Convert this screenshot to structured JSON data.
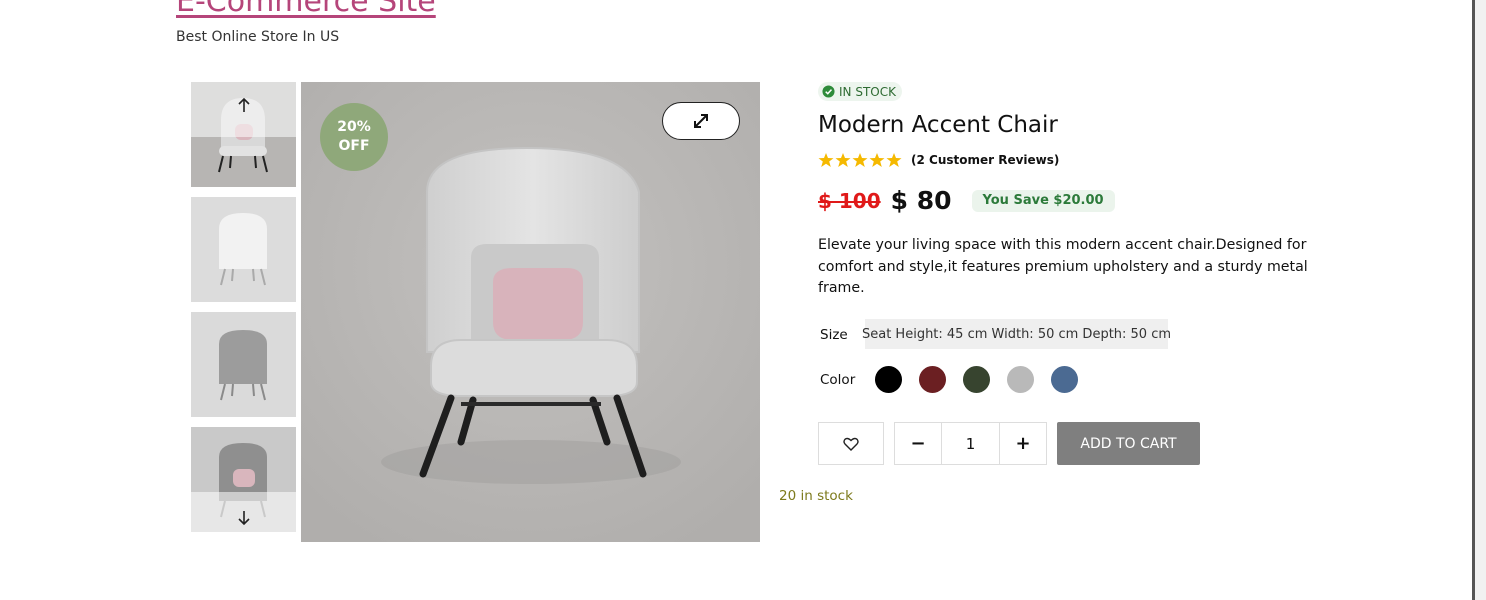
{
  "site": {
    "title": "E-Commerce Site",
    "tagline": "Best Online Store In US"
  },
  "gallery": {
    "discount_badge": {
      "line1": "20%",
      "line2": "OFF",
      "color": "#8fa87a"
    },
    "thumbnails": [
      {
        "label": "chair-front",
        "arrow": "arrow-up-icon"
      },
      {
        "label": "chair-back-white"
      },
      {
        "label": "chair-back-grey"
      },
      {
        "label": "chair-back-grey-cushion",
        "arrow": "arrow-down-icon"
      }
    ],
    "expand_icon": "expand-icon"
  },
  "product": {
    "stock_badge": "IN STOCK",
    "title": "Modern Accent Chair",
    "rating": 5,
    "reviews_text": "(2 Customer Reviews)",
    "old_price": "$ 100",
    "new_price": "$ 80",
    "save_text": "You Save $20.00",
    "description": "Elevate your living space with this modern accent chair.Designed for comfort and style,it features premium upholstery and a sturdy metal frame.",
    "size_label": "Size",
    "size_value": "Seat Height: 45 cm Width: 50 cm Depth: 50 cm",
    "color_label": "Color",
    "colors": [
      "#000000",
      "#6b1f22",
      "#37442f",
      "#b9b9b9",
      "#4b6a92"
    ],
    "quantity": "1",
    "minus_label": "−",
    "plus_label": "+",
    "add_to_cart_label": "ADD TO CART",
    "stock_count": "20 in stock"
  },
  "colors": {
    "title_link": "#b5457a",
    "old_price": "#e01919",
    "save_text": "#2c7a3a",
    "in_stock": "#2e6b32",
    "stock_count": "#7d7a1c",
    "add_to_cart_bg": "#7f7f7f"
  }
}
